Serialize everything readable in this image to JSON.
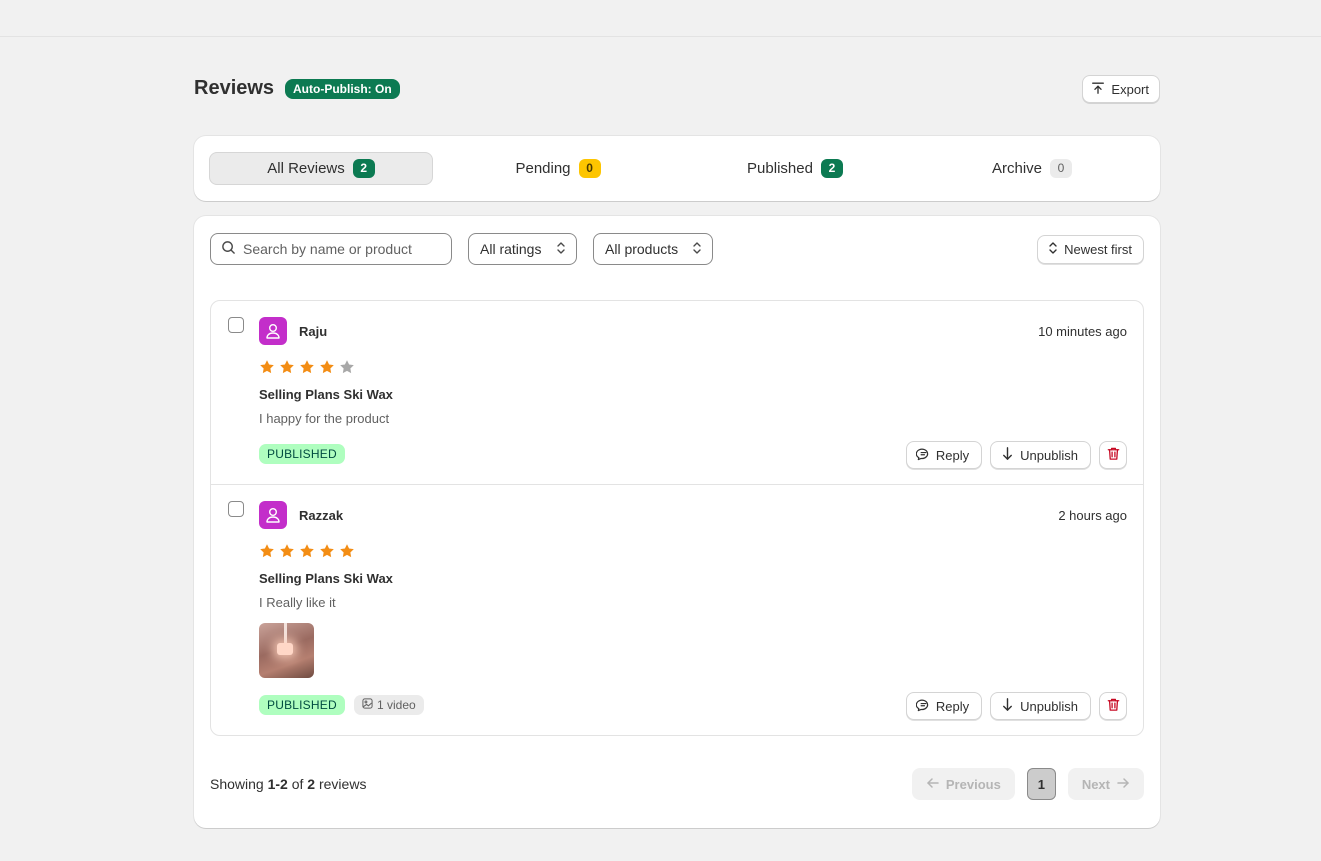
{
  "header": {
    "title": "Reviews",
    "auto_publish_badge": "Auto-Publish: On",
    "export_label": "Export"
  },
  "tabs": [
    {
      "label": "All Reviews",
      "count": "2",
      "active": true
    },
    {
      "label": "Pending",
      "count": "0"
    },
    {
      "label": "Published",
      "count": "2"
    },
    {
      "label": "Archive",
      "count": "0"
    }
  ],
  "filters": {
    "search_placeholder": "Search by name or product",
    "ratings_label": "All ratings",
    "products_label": "All products",
    "sort_label": "Newest first"
  },
  "reviews": [
    {
      "name": "Raju",
      "time": "10 minutes ago",
      "rating": 4,
      "product": "Selling Plans Ski Wax",
      "text": "I happy for the product",
      "status": "PUBLISHED",
      "reply_label": "Reply",
      "unpublish_label": "Unpublish"
    },
    {
      "name": "Razzak",
      "time": "2 hours ago",
      "rating": 5,
      "product": "Selling Plans Ski Wax",
      "text": "I Really like it",
      "status": "PUBLISHED",
      "media_label": "1 video",
      "reply_label": "Reply",
      "unpublish_label": "Unpublish"
    }
  ],
  "footer": {
    "showing_prefix": "Showing",
    "range": "1-2",
    "of_word": "of",
    "total": "2",
    "suffix": "reviews"
  },
  "pagination": {
    "previous_label": "Previous",
    "current_page": "1",
    "next_label": "Next"
  },
  "colors": {
    "star_filled": "#f38d14",
    "star_empty": "#a8a8a8",
    "delete": "#c70a24"
  }
}
